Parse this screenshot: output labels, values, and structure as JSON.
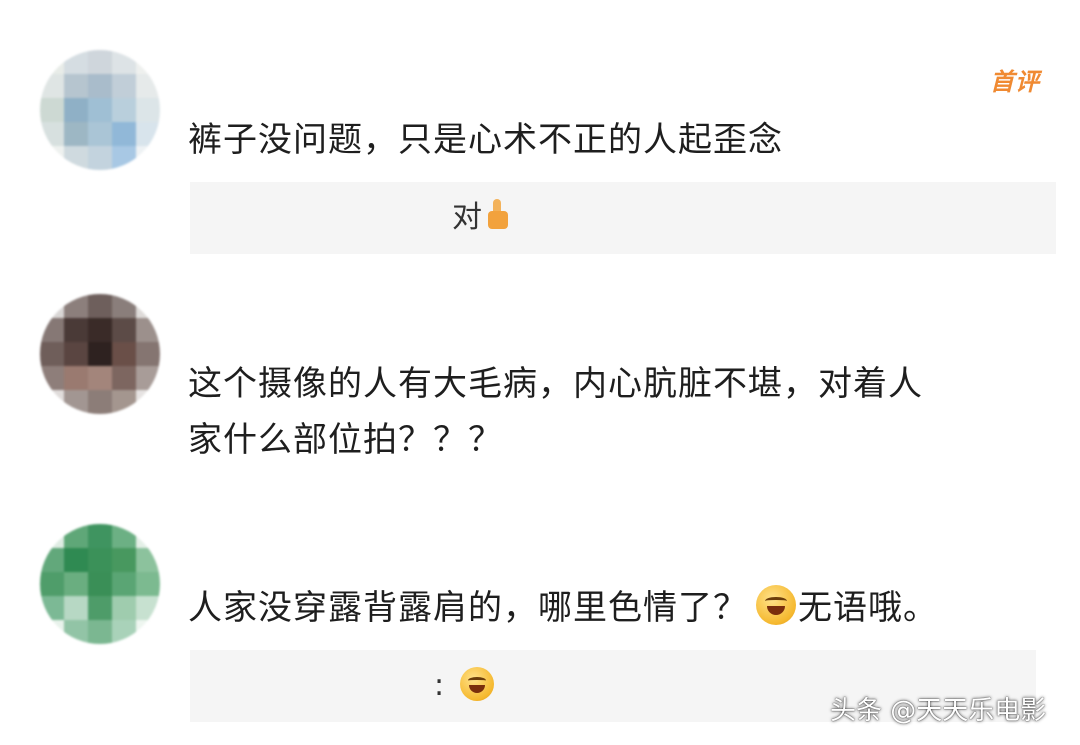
{
  "badge": {
    "label": "首评",
    "color": "#f08a32",
    "icon": "first-comment-badge"
  },
  "comments": [
    {
      "username": "",
      "text": "裤子没问题，只是心术不正的人起歪念",
      "reply": {
        "username": "",
        "text": "对",
        "emoji": "thumbs-up-icon"
      }
    },
    {
      "username": "",
      "text_lines": [
        "这个摄像的人有大毛病，内心肮脏不堪，对着人",
        "家什么部位拍？？？"
      ]
    },
    {
      "username": "",
      "text": "人家没穿露背露肩的，哪里色情了？",
      "text_emoji": "laughing-tears-icon",
      "text_suffix": "无语哦。",
      "reply": {
        "username": "",
        "text": ":",
        "emoji": "laughing-tears-icon"
      }
    }
  ],
  "watermark": {
    "text": "头条 @天天乐电影"
  }
}
